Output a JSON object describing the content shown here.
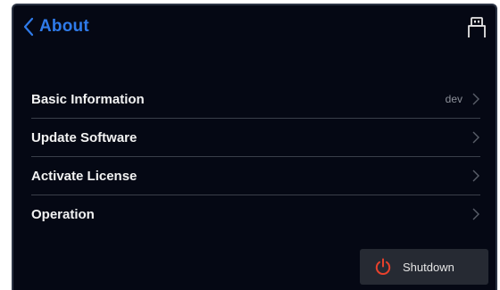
{
  "header": {
    "title": "About",
    "back_icon": "chevron-left-icon",
    "usb_icon": "usb-drive-icon",
    "accent_color": "#2f7bea"
  },
  "menu": {
    "items": [
      {
        "label": "Basic Information",
        "value": "dev"
      },
      {
        "label": "Update Software",
        "value": ""
      },
      {
        "label": "Activate License",
        "value": ""
      },
      {
        "label": "Operation",
        "value": ""
      }
    ]
  },
  "footer": {
    "shutdown_label": "Shutdown",
    "shutdown_icon": "power-icon",
    "shutdown_icon_color": "#e8412c"
  }
}
